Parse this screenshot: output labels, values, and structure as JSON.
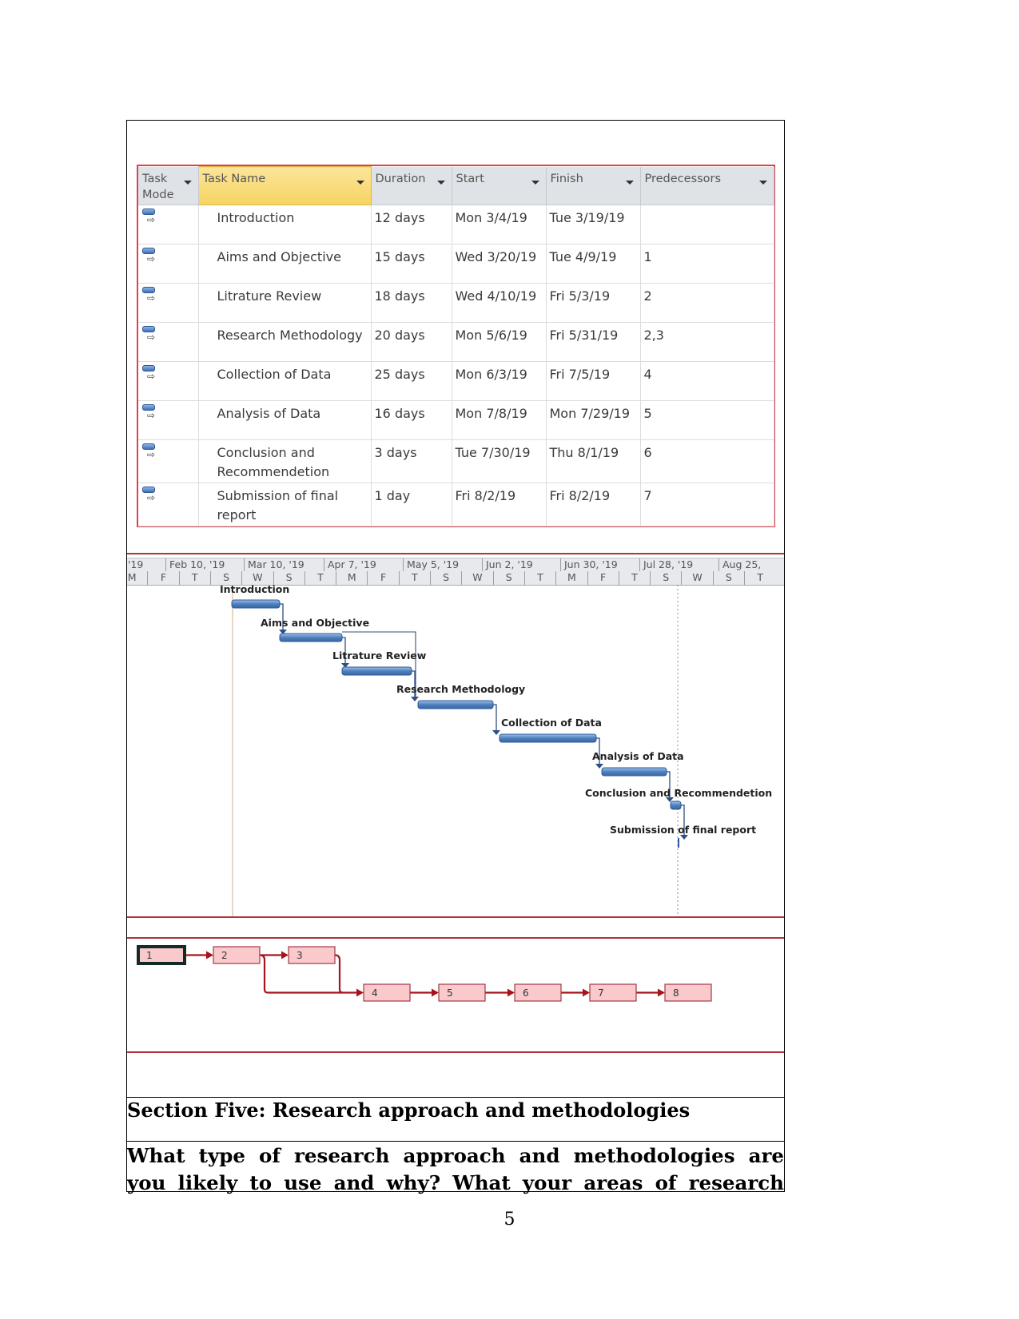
{
  "task_table": {
    "columns": [
      {
        "key": "mode",
        "label": "Task Mode"
      },
      {
        "key": "name",
        "label": "Task Name"
      },
      {
        "key": "duration",
        "label": "Duration"
      },
      {
        "key": "start",
        "label": "Start"
      },
      {
        "key": "finish",
        "label": "Finish"
      },
      {
        "key": "predecessors",
        "label": "Predecessors"
      }
    ],
    "rows": [
      {
        "id": 1,
        "mode_icon": "auto-scheduled-task-icon",
        "name": "Introduction",
        "duration": "12 days",
        "start": "Mon 3/4/19",
        "finish": "Tue 3/19/19",
        "predecessors": ""
      },
      {
        "id": 2,
        "mode_icon": "auto-scheduled-task-icon",
        "name": "Aims and Objective",
        "duration": "15 days",
        "start": "Wed 3/20/19",
        "finish": "Tue 4/9/19",
        "predecessors": "1"
      },
      {
        "id": 3,
        "mode_icon": "auto-scheduled-task-icon",
        "name": "Litrature Review",
        "duration": "18 days",
        "start": "Wed 4/10/19",
        "finish": "Fri 5/3/19",
        "predecessors": "2"
      },
      {
        "id": 4,
        "mode_icon": "auto-scheduled-task-icon",
        "name": "Research Methodology",
        "duration": "20 days",
        "start": "Mon 5/6/19",
        "finish": "Fri 5/31/19",
        "predecessors": "2,3"
      },
      {
        "id": 5,
        "mode_icon": "auto-scheduled-task-icon",
        "name": "Collection of Data",
        "duration": "25 days",
        "start": "Mon 6/3/19",
        "finish": "Fri 7/5/19",
        "predecessors": "4"
      },
      {
        "id": 6,
        "mode_icon": "auto-scheduled-task-icon",
        "name": "Analysis of Data",
        "duration": "16 days",
        "start": "Mon 7/8/19",
        "finish": "Mon 7/29/19",
        "predecessors": "5"
      },
      {
        "id": 7,
        "mode_icon": "auto-scheduled-task-icon",
        "name": "Conclusion and Recommendetion",
        "duration": "3 days",
        "start": "Tue 7/30/19",
        "finish": "Thu 8/1/19",
        "predecessors": "6"
      },
      {
        "id": 8,
        "mode_icon": "auto-scheduled-task-icon",
        "name": "Submission of final report",
        "duration": "1 day",
        "start": "Fri 8/2/19",
        "finish": "Fri 8/2/19",
        "predecessors": "7"
      }
    ]
  },
  "gantt": {
    "timescale_major": [
      "'19",
      "Feb 10, '19",
      "Mar 10, '19",
      "Apr 7, '19",
      "May 5, '19",
      "Jun 2, '19",
      "Jun 30, '19",
      "Jul 28, '19",
      "Aug 25,"
    ],
    "timescale_minor": [
      "M",
      "F",
      "T",
      "S",
      "W",
      "S",
      "T",
      "M",
      "F",
      "T",
      "S",
      "W",
      "S",
      "T",
      "M",
      "F",
      "T",
      "S",
      "W",
      "S",
      "T"
    ],
    "bar_labels": [
      "Introduction",
      "Aims and Objective",
      "Litrature Review",
      "Research Methodology",
      "Collection of Data",
      "Analysis of Data",
      "Conclusion and Recommendetion",
      "Submission of final report"
    ],
    "colors": {
      "bar": "#4f81bd",
      "bar_border": "#2f5a98",
      "link": "#2f4f7f",
      "frame": "#b2323b"
    }
  },
  "network": {
    "nodes": [
      "1",
      "2",
      "3",
      "4",
      "5",
      "6",
      "7",
      "8"
    ],
    "colors": {
      "node_fill": "#f9c9cc",
      "node_border": "#a33a44",
      "link": "#a8141e",
      "selected_border": "#142a27"
    }
  },
  "section": {
    "heading": "Section Five: Research approach and methodologies",
    "question_line1": "What type of research approach and methodologies are",
    "question_line2": "you likely to use and why? What your areas of research"
  },
  "page_number": "5"
}
